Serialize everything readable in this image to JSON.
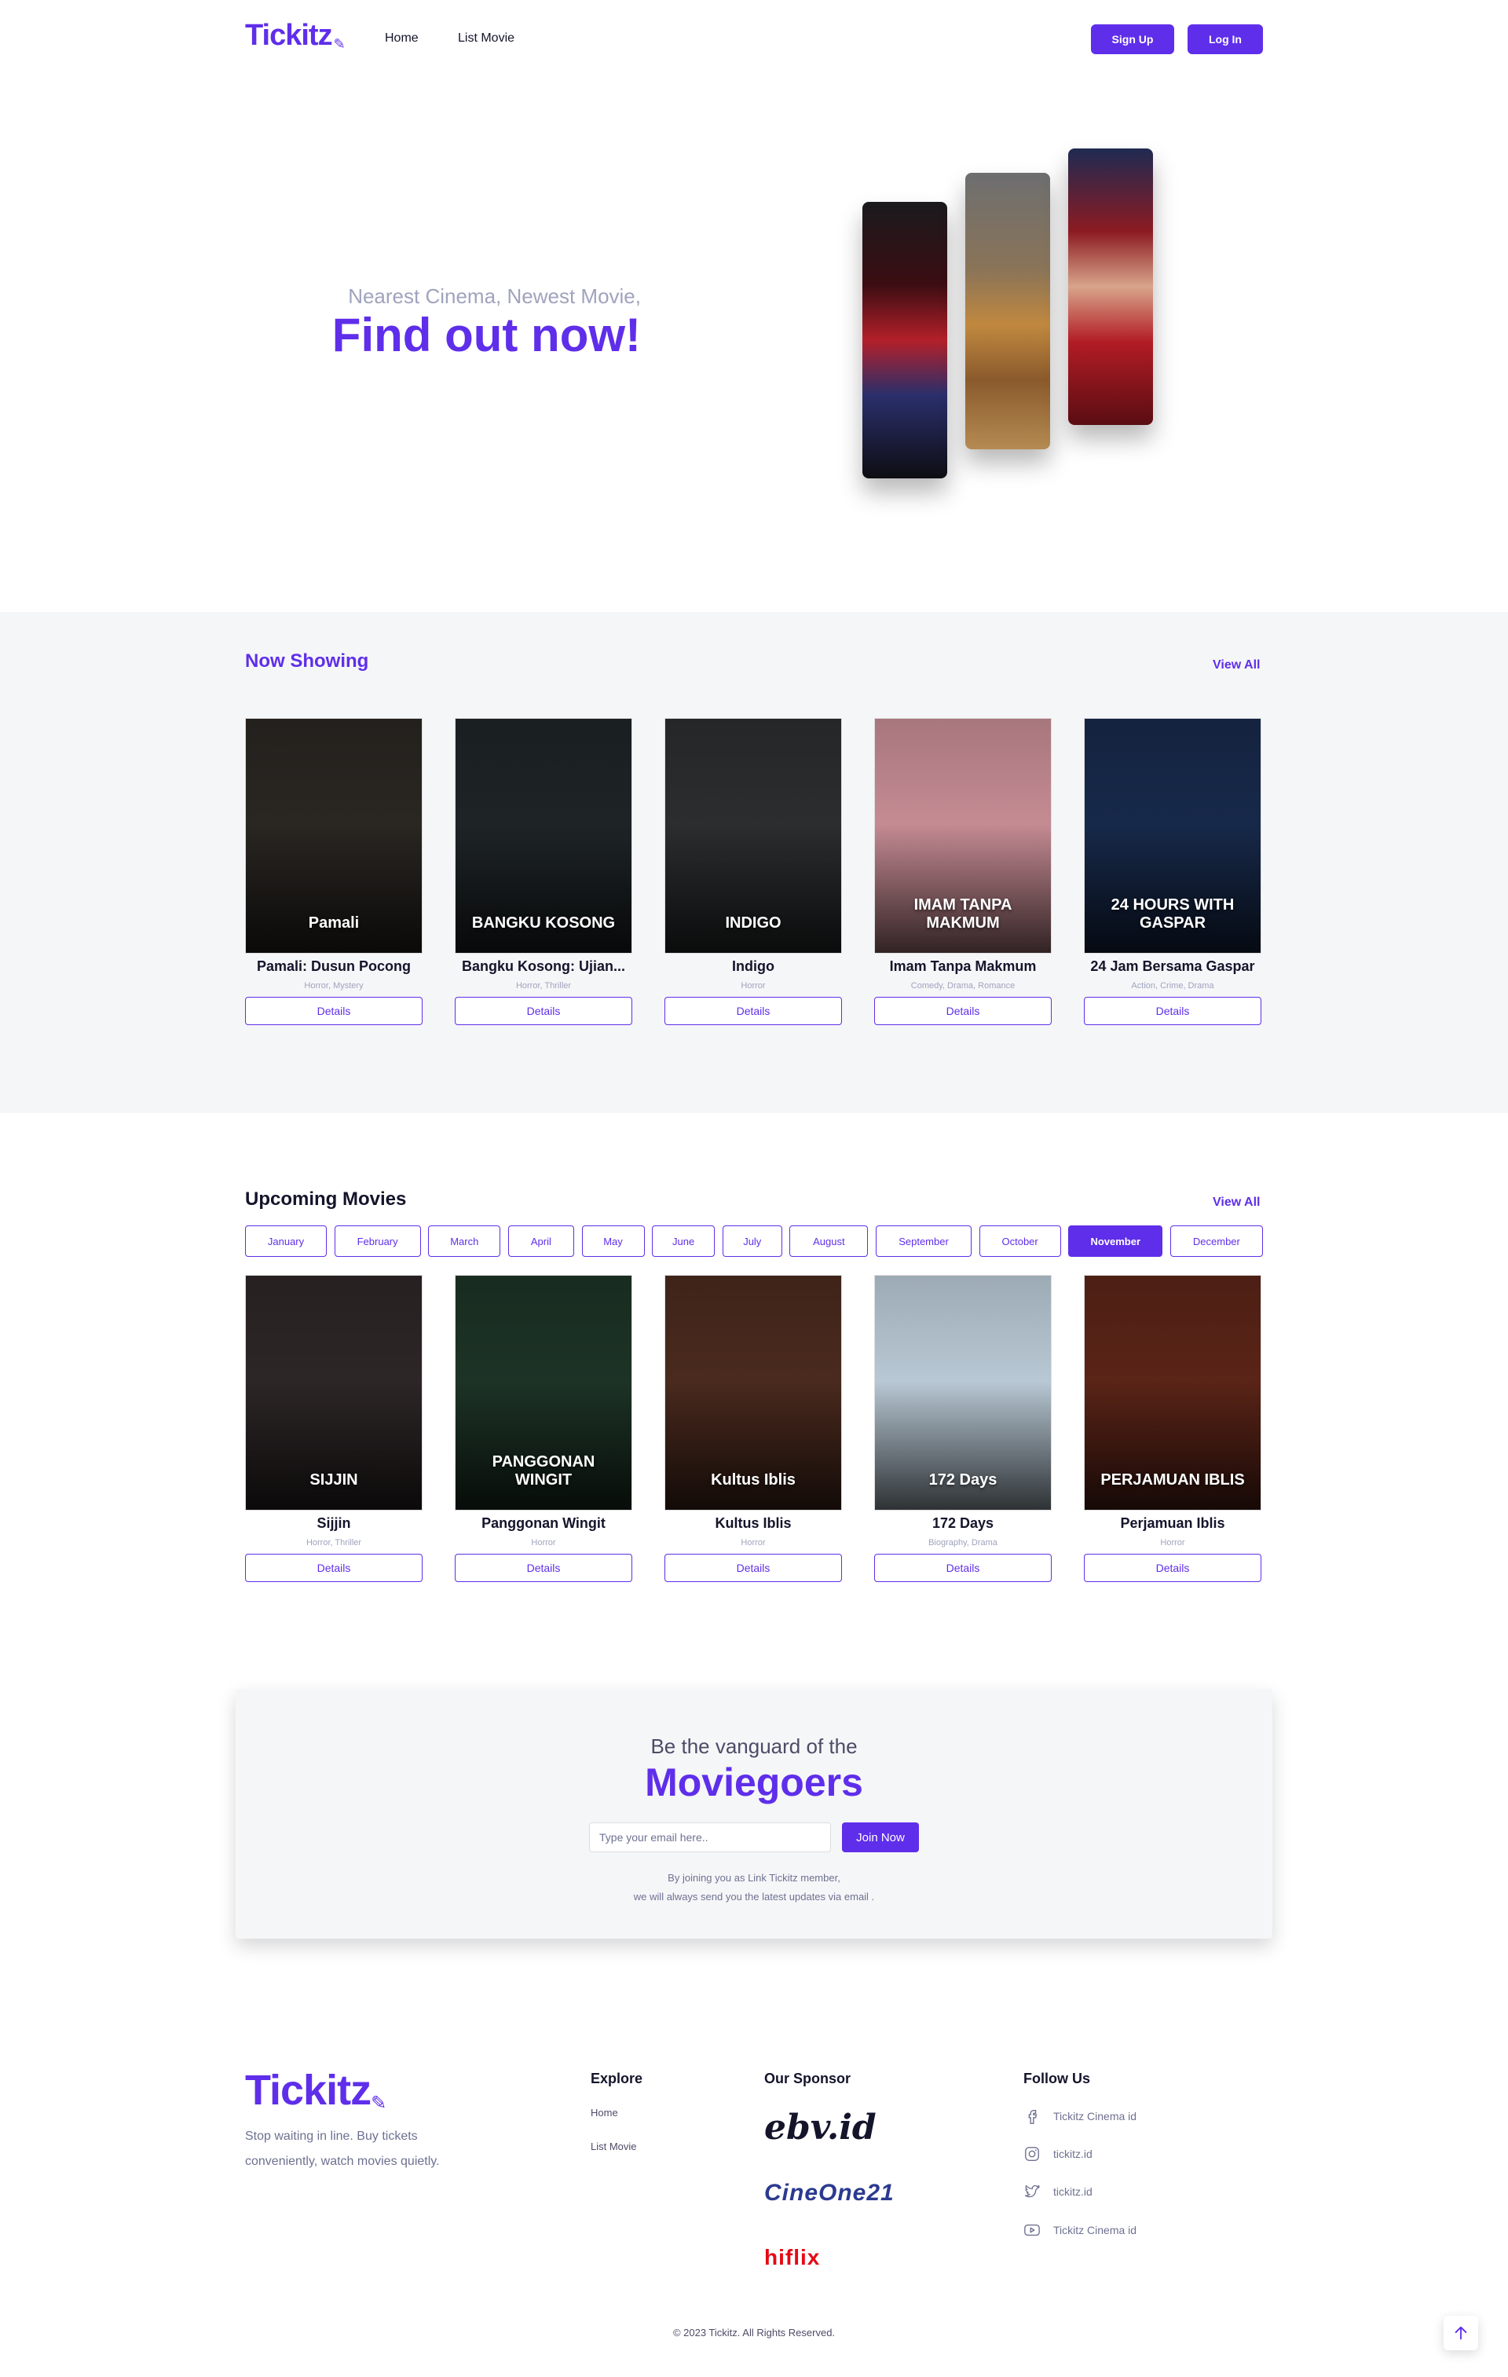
{
  "nav": {
    "logo": "Tickitz",
    "links": [
      "Home",
      "List Movie"
    ],
    "signup": "Sign Up",
    "login": "Log In"
  },
  "hero": {
    "subtitle": "Nearest Cinema, Newest Movie,",
    "title": "Find out now!"
  },
  "now_showing": {
    "title": "Now Showing",
    "view_all": "View All",
    "movies": [
      {
        "title": "Pamali: Dusun Pocong",
        "genre": "Horror, Mystery",
        "poster_text": "Pamali",
        "details": "Details",
        "color": "#2a2622"
      },
      {
        "title": "Bangku Kosong: Ujian...",
        "genre": "Horror, Thriller",
        "poster_text": "BANGKU KOSONG",
        "details": "Details",
        "color": "#1e2426"
      },
      {
        "title": "Indigo",
        "genre": "Horror",
        "poster_text": "INDIGO",
        "details": "Details",
        "color": "#2b2d2f"
      },
      {
        "title": "Imam Tanpa Makmum",
        "genre": "Comedy, Drama, Romance",
        "poster_text": "IMAM TANPA MAKMUM",
        "details": "Details",
        "color": "#c58b93"
      },
      {
        "title": "24 Jam Bersama Gaspar",
        "genre": "Action, Crime, Drama",
        "poster_text": "24 HOURS WITH GASPAR",
        "details": "Details",
        "color": "#17294a"
      }
    ]
  },
  "upcoming": {
    "title": "Upcoming Movies",
    "view_all": "View All",
    "months": [
      "January",
      "February",
      "March",
      "April",
      "May",
      "June",
      "July",
      "August",
      "September",
      "October",
      "November",
      "December"
    ],
    "active_month": "November",
    "movies": [
      {
        "title": "Sijjin",
        "genre": "Horror, Thriller",
        "poster_text": "SIJJIN",
        "details": "Details",
        "color": "#2d2627"
      },
      {
        "title": "Panggonan Wingit",
        "genre": "Horror",
        "poster_text": "PANGGONAN WINGIT",
        "details": "Details",
        "color": "#1d3326"
      },
      {
        "title": "Kultus Iblis",
        "genre": "Horror",
        "poster_text": "Kultus Iblis",
        "details": "Details",
        "color": "#4a2a1e"
      },
      {
        "title": "172 Days",
        "genre": "Biography, Drama",
        "poster_text": "172 Days",
        "details": "Details",
        "color": "#b8c8d4"
      },
      {
        "title": "Perjamuan Iblis",
        "genre": "Horror",
        "poster_text": "PERJAMUAN IBLIS",
        "details": "Details",
        "color": "#5a2417"
      }
    ]
  },
  "newsletter": {
    "subtitle": "Be the vanguard of the",
    "title": "Moviegoers",
    "placeholder": "Type your email here..",
    "button": "Join Now",
    "note_line1": "By joining you as Link Tickitz member,",
    "note_line2": "we will always send you the latest updates via email ."
  },
  "footer": {
    "logo": "Tickitz",
    "desc_line1": "Stop waiting in line. Buy tickets",
    "desc_line2": "conveniently, watch movies quietly.",
    "explore_title": "Explore",
    "explore_links": [
      "Home",
      "List Movie"
    ],
    "sponsor_title": "Our Sponsor",
    "sponsors": [
      "ebv.id",
      "CineOne21",
      "hiflix"
    ],
    "follow_title": "Follow Us",
    "follow": [
      {
        "icon": "facebook-icon",
        "label": "Tickitz Cinema id"
      },
      {
        "icon": "instagram-icon",
        "label": "tickitz.id"
      },
      {
        "icon": "twitter-icon",
        "label": "tickitz.id"
      },
      {
        "icon": "youtube-icon",
        "label": "Tickitz Cinema id"
      }
    ],
    "copyright": "© 2023 Tickitz. All Rights Reserved."
  },
  "colors": {
    "primary": "#5f2eea",
    "section_bg": "#f5f6f8",
    "muted": "#a0a3bd"
  }
}
